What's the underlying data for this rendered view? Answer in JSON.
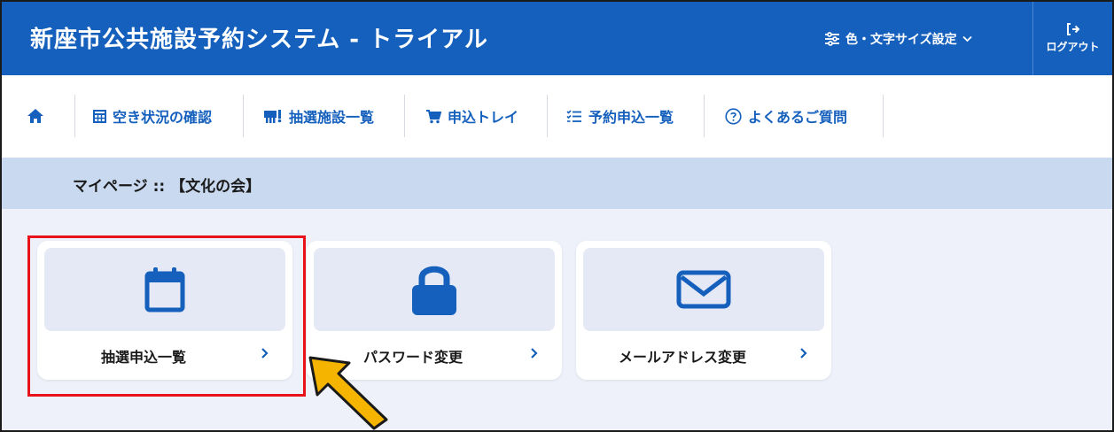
{
  "header": {
    "title": "新座市公共施設予約システム - トライアル",
    "settings_label": "色・文字サイズ設定",
    "logout_label": "ログアウト"
  },
  "nav": {
    "items": [
      {
        "label": "空き状況の確認",
        "icon": "calendar-grid-icon"
      },
      {
        "label": "抽選施設一覧",
        "icon": "lottery-icon"
      },
      {
        "label": "申込トレイ",
        "icon": "cart-icon"
      },
      {
        "label": "予約申込一覧",
        "icon": "list-icon"
      },
      {
        "label": "よくあるご質問",
        "icon": "help-circle-icon"
      }
    ]
  },
  "page": {
    "title": "マイページ :: 【文化の会】"
  },
  "cards": [
    {
      "label": "抽選申込一覧",
      "icon": "calendar-icon"
    },
    {
      "label": "パスワード変更",
      "icon": "lock-icon"
    },
    {
      "label": "メールアドレス変更",
      "icon": "envelope-icon"
    }
  ],
  "colors": {
    "primary": "#1560bd",
    "page_bar": "#c9daf0",
    "background": "#eef1fa",
    "highlight": "#e8121b",
    "arrow": "#f5b400"
  }
}
